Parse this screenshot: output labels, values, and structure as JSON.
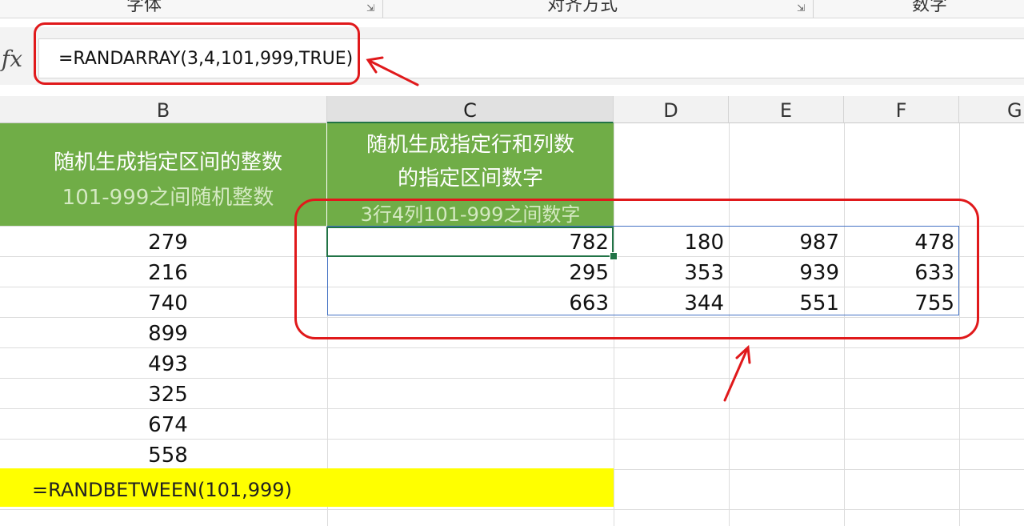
{
  "ribbon": {
    "groups": [
      "字体",
      "对齐方式",
      "数字"
    ]
  },
  "formula_bar": {
    "fx_label": "fx",
    "formula": "=RANDARRAY(3,4,101,999,TRUE)"
  },
  "columns": [
    "B",
    "C",
    "D",
    "E",
    "F",
    "G"
  ],
  "active_column": "C",
  "header_b": {
    "line1": "随机生成指定区间的整数",
    "line2": "101-999之间随机整数"
  },
  "header_c": {
    "line1": "随机生成指定行和列数",
    "line2": "的指定区间数字",
    "line3": "3行4列101-999之间数字"
  },
  "column_b_values": [
    "279",
    "216",
    "740",
    "899",
    "493",
    "325",
    "674",
    "558"
  ],
  "spill_rows": [
    [
      "782",
      "180",
      "987",
      "478"
    ],
    [
      "295",
      "353",
      "939",
      "633"
    ],
    [
      "663",
      "344",
      "551",
      "755"
    ]
  ],
  "yellow_formula": "=RANDBETWEEN(101,999)",
  "colors": {
    "header_green": "#70ad47",
    "selection_green": "#217346",
    "spill_blue": "#4472c4",
    "highlight_yellow": "#ffff00",
    "annotation_red": "#e0191b"
  }
}
